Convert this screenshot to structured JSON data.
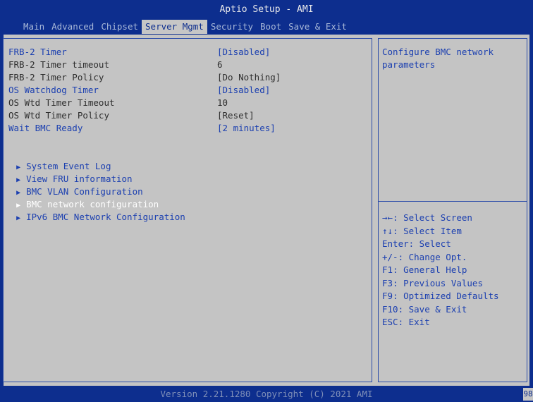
{
  "title": "Aptio Setup - AMI",
  "menu": {
    "tabs": [
      "Main",
      "Advanced",
      "Chipset",
      "Server Mgmt",
      "Security",
      "Boot",
      "Save & Exit"
    ],
    "active": "Server Mgmt"
  },
  "settings": [
    {
      "label": "FRB-2 Timer",
      "value": "[Disabled]",
      "selectable": true
    },
    {
      "label": "FRB-2 Timer timeout",
      "value": "6",
      "selectable": false
    },
    {
      "label": "FRB-2 Timer Policy",
      "value": "[Do Nothing]",
      "selectable": false
    },
    {
      "label": "OS Watchdog Timer",
      "value": "[Disabled]",
      "selectable": true
    },
    {
      "label": "OS Wtd Timer Timeout",
      "value": "10",
      "selectable": false
    },
    {
      "label": "OS Wtd Timer Policy",
      "value": "[Reset]",
      "selectable": false
    },
    {
      "label": "Wait BMC Ready",
      "value": "[2 minutes]",
      "selectable": true
    }
  ],
  "submenus": [
    {
      "label": "System Event Log",
      "selected": false
    },
    {
      "label": "View FRU information",
      "selected": false
    },
    {
      "label": "BMC VLAN Configuration",
      "selected": false
    },
    {
      "label": "BMC network configuration",
      "selected": true
    },
    {
      "label": "IPv6 BMC Network Configuration",
      "selected": false
    }
  ],
  "help_text": [
    "Configure BMC network",
    "parameters"
  ],
  "key_help": [
    "→←: Select Screen",
    "↑↓: Select Item",
    "Enter: Select",
    "+/-: Change Opt.",
    "F1: General Help",
    "F3: Previous Values",
    "F9: Optimized Defaults",
    "F10: Save & Exit",
    "ESC: Exit"
  ],
  "footer": {
    "version": "Version 2.21.1280 Copyright (C) 2021 AMI",
    "badge": "98"
  },
  "icons": {
    "submenu": "triangle-right-icon"
  },
  "colors": {
    "frame_blue": "#0d2e8e",
    "panel_gray": "#c4c4c4",
    "selectable_text": "#1b3fb0",
    "static_text": "#2e2e2e",
    "highlight_text": "#ffffff"
  }
}
